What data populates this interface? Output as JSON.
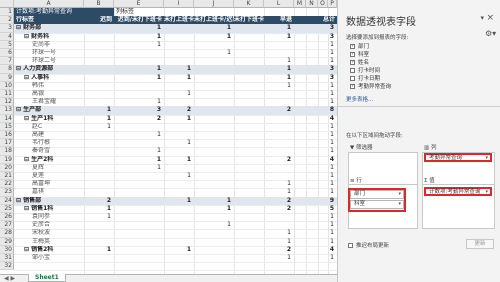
{
  "columns": [
    "A",
    "B",
    "E",
    "I",
    "J",
    "K",
    "L",
    "M",
    "N",
    "O",
    "P"
  ],
  "rows_nums": [
    "1",
    "2",
    "3",
    "4",
    "5",
    "6",
    "7",
    "8",
    "9",
    "10",
    "11",
    "12",
    "13",
    "14",
    "15",
    "16",
    "17",
    "18",
    "19",
    "20",
    "21",
    "22",
    "23",
    "24",
    "25",
    "26",
    "27",
    "28",
    "29",
    "30",
    "31",
    "32"
  ],
  "filter": {
    "label": "计数项:考勤异常查询",
    "col_label": "列标签"
  },
  "header": {
    "row_label": "行标签",
    "cols": [
      "迟到",
      "迟到/未打下班卡",
      "未打上班卡",
      "未打上班卡/迟到",
      "未打下班卡",
      "早退",
      "总计"
    ]
  },
  "rows": [
    {
      "label": "财务部",
      "level": 0,
      "vals": [
        "",
        "1",
        "",
        "1",
        "",
        "1",
        "3"
      ],
      "band": true
    },
    {
      "label": "财务科",
      "level": 1,
      "vals": [
        "",
        "1",
        "",
        "1",
        "",
        "1",
        "3"
      ],
      "band": false
    },
    {
      "label": "史尚非",
      "level": 2,
      "vals": [
        "",
        "1",
        "",
        "",
        "",
        "",
        "1"
      ],
      "band": false
    },
    {
      "label": "环球一号",
      "level": 2,
      "vals": [
        "",
        "",
        "",
        "1",
        "",
        "",
        "1"
      ],
      "band": false
    },
    {
      "label": "环球二号",
      "level": 2,
      "vals": [
        "",
        "",
        "",
        "",
        "",
        "1",
        "1"
      ],
      "band": false
    },
    {
      "label": "人力资源部",
      "level": 0,
      "vals": [
        "",
        "1",
        "1",
        "",
        "",
        "1",
        "3"
      ],
      "band": true
    },
    {
      "label": "人事科",
      "level": 1,
      "vals": [
        "",
        "1",
        "1",
        "",
        "",
        "1",
        "3"
      ],
      "band": false
    },
    {
      "label": "韩伟",
      "level": 2,
      "vals": [
        "",
        "",
        "",
        "",
        "",
        "1",
        "1"
      ],
      "band": false
    },
    {
      "label": "高银",
      "level": 2,
      "vals": [
        "",
        "",
        "1",
        "",
        "",
        "",
        "1"
      ],
      "band": false
    },
    {
      "label": "王君宝耀",
      "level": 2,
      "vals": [
        "",
        "1",
        "",
        "",
        "",
        "",
        "1"
      ],
      "band": false
    },
    {
      "label": "生产部",
      "level": 0,
      "vals": [
        "1",
        "3",
        "2",
        "",
        "",
        "2",
        "8"
      ],
      "band": true
    },
    {
      "label": "生产1科",
      "level": 1,
      "vals": [
        "1",
        "2",
        "1",
        "",
        "",
        "",
        "4"
      ],
      "band": false
    },
    {
      "label": "赵C",
      "level": 2,
      "vals": [
        "1",
        "",
        "",
        "",
        "",
        "",
        "1"
      ],
      "band": false
    },
    {
      "label": "高建",
      "level": 2,
      "vals": [
        "",
        "1",
        "",
        "",
        "",
        "",
        "1"
      ],
      "band": false
    },
    {
      "label": "韦行根",
      "level": 2,
      "vals": [
        "",
        "",
        "1",
        "",
        "",
        "",
        "1"
      ],
      "band": false
    },
    {
      "label": "秦奇雪",
      "level": 2,
      "vals": [
        "",
        "1",
        "",
        "",
        "",
        "",
        "1"
      ],
      "band": false
    },
    {
      "label": "生产2科",
      "level": 1,
      "vals": [
        "",
        "1",
        "1",
        "",
        "",
        "2",
        "4"
      ],
      "band": false
    },
    {
      "label": "夏辉",
      "level": 2,
      "vals": [
        "",
        "1",
        "",
        "",
        "",
        "",
        "1"
      ],
      "band": false
    },
    {
      "label": "夏莲",
      "level": 2,
      "vals": [
        "",
        "",
        "1",
        "",
        "",
        "",
        "1"
      ],
      "band": false
    },
    {
      "label": "高富坤",
      "level": 2,
      "vals": [
        "",
        "",
        "",
        "",
        "",
        "1",
        "1"
      ],
      "band": false
    },
    {
      "label": "嘉祺",
      "level": 2,
      "vals": [
        "",
        "",
        "",
        "",
        "",
        "1",
        "1"
      ],
      "band": false
    },
    {
      "label": "销售部",
      "level": 0,
      "vals": [
        "2",
        "",
        "1",
        "1",
        "",
        "2",
        "9"
      ],
      "band": true
    },
    {
      "label": "销售1科",
      "level": 1,
      "vals": [
        "1",
        "",
        "",
        "1",
        "",
        "2",
        "5"
      ],
      "band": false
    },
    {
      "label": "袁同参",
      "level": 2,
      "vals": [
        "1",
        "",
        "",
        "",
        "",
        "",
        "1"
      ],
      "band": false
    },
    {
      "label": "史彦合",
      "level": 2,
      "vals": [
        "",
        "",
        "",
        "1",
        "",
        "",
        "1"
      ],
      "band": false
    },
    {
      "label": "宋秋波",
      "level": 2,
      "vals": [
        "",
        "",
        "",
        "",
        "",
        "1",
        "1"
      ],
      "band": false
    },
    {
      "label": "王梅英",
      "level": 2,
      "vals": [
        "",
        "",
        "",
        "",
        "",
        "1",
        "1"
      ],
      "band": false
    },
    {
      "label": "销售2科",
      "level": 1,
      "vals": [
        "1",
        "",
        "1",
        "",
        "",
        "2",
        "4"
      ],
      "band": false
    },
    {
      "label": "邹小宝",
      "level": 2,
      "vals": [
        "",
        "",
        "",
        "",
        "",
        "1",
        "1"
      ],
      "band": false
    }
  ],
  "sheet_tab": "Sheet1",
  "pane": {
    "title": "数据透视表字段",
    "close": "×",
    "dropdown": "▾",
    "choose_label": "选择要添加到报表的字段:",
    "gear": "⚙▾",
    "fields": [
      {
        "label": "部门",
        "checked": true
      },
      {
        "label": "科室",
        "checked": true
      },
      {
        "label": "姓名",
        "checked": true
      },
      {
        "label": "打卡时间",
        "checked": false
      },
      {
        "label": "打卡日期",
        "checked": false
      },
      {
        "label": "考勤异常查询",
        "checked": true
      }
    ],
    "more_tables": "更多表格...",
    "drag_label": "在以下区域间拖动字段:",
    "filter_zone": "筛选器",
    "col_zone": "列",
    "row_zone": "行",
    "val_zone": "值",
    "col_chip": "考勤异常查询",
    "row_chips": [
      "部门",
      "科室"
    ],
    "val_chip": "计数项:考勤异常查询",
    "defer": "推迟布局更新",
    "update": "更新"
  }
}
